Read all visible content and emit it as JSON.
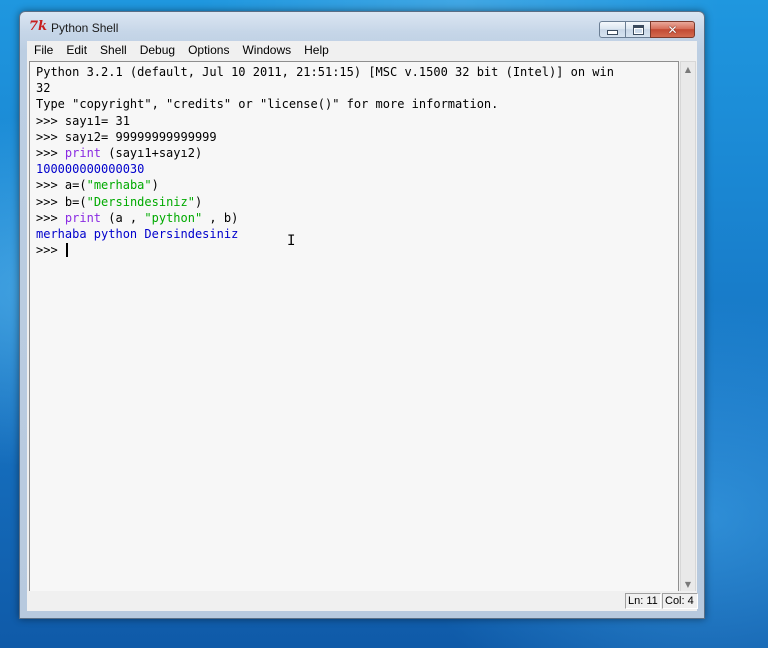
{
  "window": {
    "title": "Python Shell",
    "icon": "tk-icon",
    "icon_glyph": "7k",
    "controls": {
      "minimize": "minimize-icon",
      "maximize": "maximize-icon",
      "close": "close-icon",
      "close_glyph": "✕"
    }
  },
  "menu": [
    {
      "label": "File"
    },
    {
      "label": "Edit"
    },
    {
      "label": "Shell"
    },
    {
      "label": "Debug"
    },
    {
      "label": "Options"
    },
    {
      "label": "Windows"
    },
    {
      "label": "Help"
    }
  ],
  "shell": {
    "lines": [
      [
        {
          "text": "Python 3.2.1 (default, Jul 10 2011, 21:51:15) [MSC v.1500 32 bit (Intel)] on win",
          "style": "plain"
        }
      ],
      [
        {
          "text": "32",
          "style": "plain"
        }
      ],
      [
        {
          "text": "Type \"copyright\", \"credits\" or \"license()\" for more information.",
          "style": "plain"
        }
      ],
      [
        {
          "text": ">>> ",
          "style": "plain"
        },
        {
          "text": "sayı1= 31",
          "style": "plain"
        }
      ],
      [
        {
          "text": ">>> ",
          "style": "plain"
        },
        {
          "text": "sayı2= 99999999999999",
          "style": "plain"
        }
      ],
      [
        {
          "text": ">>> ",
          "style": "plain"
        },
        {
          "text": "print",
          "style": "kwprint"
        },
        {
          "text": " (sayı1+sayı2)",
          "style": "plain"
        }
      ],
      [
        {
          "text": "100000000000030",
          "style": "out"
        }
      ],
      [
        {
          "text": ">>> ",
          "style": "plain"
        },
        {
          "text": "a=(",
          "style": "plain"
        },
        {
          "text": "\"merhaba\"",
          "style": "str"
        },
        {
          "text": ")",
          "style": "plain"
        }
      ],
      [
        {
          "text": ">>> ",
          "style": "plain"
        },
        {
          "text": "b=(",
          "style": "plain"
        },
        {
          "text": "\"Dersindesiniz\"",
          "style": "str"
        },
        {
          "text": ")",
          "style": "plain"
        }
      ],
      [
        {
          "text": ">>> ",
          "style": "plain"
        },
        {
          "text": "print",
          "style": "kwprint"
        },
        {
          "text": " (a , ",
          "style": "plain"
        },
        {
          "text": "\"python\"",
          "style": "str"
        },
        {
          "text": " , b)",
          "style": "plain"
        }
      ],
      [
        {
          "text": "merhaba python Dersindesiniz",
          "style": "out"
        }
      ],
      [
        {
          "text": ">>> ",
          "style": "plain"
        }
      ]
    ],
    "mouse_cursor": "ibeam-cursor-icon",
    "mouse_glyph": "I"
  },
  "scrollbar": {
    "up_glyph": "▲",
    "down_glyph": "▼"
  },
  "status": {
    "line": "Ln: 11",
    "col": "Col: 4"
  },
  "colors": {
    "desktop": "#1a86d2",
    "string": "#00aa00",
    "keyword": "#8a2be2",
    "output": "#0000cc"
  }
}
